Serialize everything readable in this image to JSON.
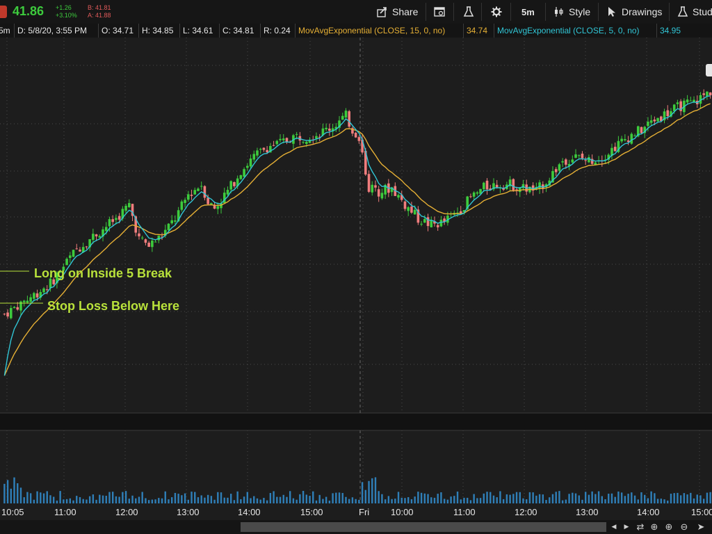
{
  "quote": {
    "last": "41.86",
    "change": "+1.26",
    "change_pct": "+3.10%",
    "bid": "B: 41.81",
    "ask": "A: 41.88"
  },
  "toolbar": {
    "share": "Share",
    "timeframe": "5m",
    "style": "Style",
    "drawings": "Drawings",
    "studies": "Stud"
  },
  "infobar": {
    "period": "5m",
    "date": "D: 5/8/20, 3:55 PM",
    "open": "O: 34.71",
    "high": "H: 34.85",
    "low": "L: 34.61",
    "close": "C: 34.81",
    "range": "R: 0.24",
    "ema15_label": "MovAvgExponential (CLOSE, 15, 0, no)",
    "ema15_value": "34.74",
    "ema5_label": "MovAvgExponential (CLOSE, 5, 0, no)",
    "ema5_value": "34.95"
  },
  "annotations": {
    "long": "Long on Inside 5 Break",
    "stop": "Stop Loss Below Here"
  },
  "colors": {
    "up": "#3dcb3d",
    "down": "#f07d7d",
    "ema15": "#e6b035",
    "ema5": "#31c6d6",
    "volume": "#2f7fb8",
    "annotation": "#b9e23b"
  },
  "chart_data": {
    "type": "candlestick",
    "title": "",
    "xlabel": "",
    "ylabel": "",
    "x_ticks": [
      "10:05",
      "11:00",
      "12:00",
      "13:00",
      "14:00",
      "15:00",
      "Fri",
      "10:00",
      "11:00",
      "12:00",
      "13:00",
      "14:00",
      "15:00"
    ],
    "ylim": [
      31.0,
      36.5
    ],
    "series": [
      {
        "name": "MovAvgExponential (CLOSE, 15, 0, no)",
        "value": 34.74
      },
      {
        "name": "MovAvgExponential (CLOSE, 5, 0, no)",
        "value": 34.95
      }
    ],
    "close_path": [
      [
        0,
        32.45
      ],
      [
        8,
        32.7
      ],
      [
        14,
        32.9
      ],
      [
        18,
        33.15
      ],
      [
        22,
        33.4
      ],
      [
        26,
        33.55
      ],
      [
        30,
        33.7
      ],
      [
        34,
        33.85
      ],
      [
        38,
        34.05
      ],
      [
        41,
        33.55
      ],
      [
        44,
        33.45
      ],
      [
        48,
        33.6
      ],
      [
        52,
        33.85
      ],
      [
        56,
        34.2
      ],
      [
        60,
        34.35
      ],
      [
        62,
        34.1
      ],
      [
        64,
        34.0
      ],
      [
        68,
        34.25
      ],
      [
        72,
        34.55
      ],
      [
        76,
        34.75
      ],
      [
        80,
        34.9
      ],
      [
        84,
        34.95
      ],
      [
        88,
        35.05
      ],
      [
        92,
        35.05
      ],
      [
        96,
        35.1
      ],
      [
        100,
        35.2
      ],
      [
        104,
        35.35
      ],
      [
        106,
        35.15
      ],
      [
        108,
        35.05
      ],
      [
        111,
        34.3
      ],
      [
        114,
        34.25
      ],
      [
        118,
        34.3
      ],
      [
        122,
        34.05
      ],
      [
        126,
        33.85
      ],
      [
        130,
        33.75
      ],
      [
        134,
        33.8
      ],
      [
        138,
        33.95
      ],
      [
        142,
        34.15
      ],
      [
        146,
        34.3
      ],
      [
        150,
        34.35
      ],
      [
        154,
        34.35
      ],
      [
        158,
        34.3
      ],
      [
        162,
        34.25
      ],
      [
        166,
        34.45
      ],
      [
        170,
        34.7
      ],
      [
        174,
        34.75
      ],
      [
        178,
        34.7
      ],
      [
        182,
        34.75
      ],
      [
        186,
        34.9
      ],
      [
        190,
        35.05
      ],
      [
        194,
        35.15
      ],
      [
        198,
        35.3
      ],
      [
        202,
        35.4
      ],
      [
        206,
        35.5
      ],
      [
        210,
        35.55
      ],
      [
        216,
        35.75
      ]
    ],
    "volume_bars": 216
  }
}
